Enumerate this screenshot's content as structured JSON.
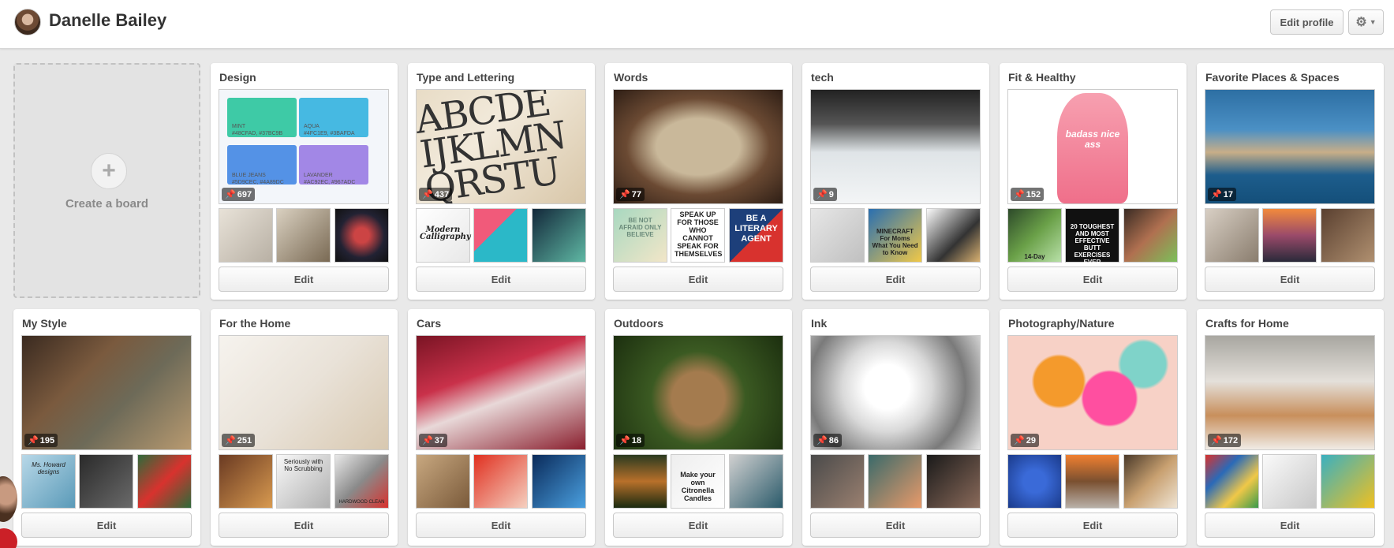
{
  "header": {
    "username": "Danelle Bailey",
    "edit_profile_label": "Edit profile",
    "settings_icon": "gear-icon"
  },
  "create_board": {
    "plus": "+",
    "label": "Create a board"
  },
  "edit_label": "Edit",
  "pin_icon": "pin-icon",
  "boards": [
    {
      "title": "Design",
      "pins": "697"
    },
    {
      "title": "Type and Lettering",
      "pins": "437"
    },
    {
      "title": "Words",
      "pins": "77"
    },
    {
      "title": "tech",
      "pins": "9"
    },
    {
      "title": "Fit & Healthy",
      "pins": "152"
    },
    {
      "title": "Favorite Places & Spaces",
      "pins": "17"
    },
    {
      "title": "My Style",
      "pins": "195"
    },
    {
      "title": "For the Home",
      "pins": "251"
    },
    {
      "title": "Cars",
      "pins": "37"
    },
    {
      "title": "Outdoors",
      "pins": "18"
    },
    {
      "title": "Ink",
      "pins": "86"
    },
    {
      "title": "Photography/Nature",
      "pins": "29"
    },
    {
      "title": "Crafts for Home",
      "pins": "172"
    }
  ],
  "design_cover": {
    "swatches": [
      {
        "name": "MINT",
        "codes": "#48CFAD, #37BC9B",
        "color": "#3ecaa6"
      },
      {
        "name": "AQUA",
        "codes": "#4FC1E9, #3BAFDA",
        "color": "#46b9e2"
      },
      {
        "name": "BLUE JEANS",
        "codes": "#5D9CEC, #4A89DC",
        "color": "#5492e6"
      },
      {
        "name": "LAVANDER",
        "codes": "#AC92EC, #967ADC",
        "color": "#a287e6"
      }
    ]
  },
  "type_cover_text": "ABCDE\nIJKLMN\nQRSTU",
  "thumb_texts": {
    "type_1": "Modern Calligraphy",
    "words_1": "BE NOT AFRAID ONLY BELIEVE",
    "words_2": "SPEAK UP FOR THOSE WHO CANNOT SPEAK FOR THEMSELVES",
    "words_3": "BE A LITERARY AGENT",
    "tech_2": "MINECRAFT For Moms What You Need to Know",
    "fit_1": "14-Day",
    "fit_2": "20 TOUGHEST AND MOST EFFECTIVE BUTT EXERCISES EVER",
    "style_1": "Ms. Howard designs",
    "home_2": "Seriously with No Scrubbing",
    "home_3": "HARDWOOD CLEAN",
    "outdoors_2": "Make your own Citronella Candles"
  },
  "fit_cover_text": "badass nice ass"
}
